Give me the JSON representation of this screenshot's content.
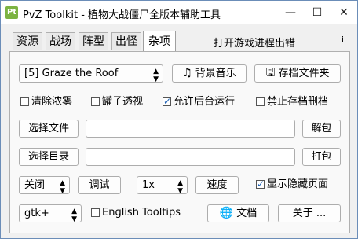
{
  "window": {
    "icon_text": "Pt",
    "title": "PvZ Toolkit - 植物大战僵尸全版本辅助工具",
    "minimize_glyph": "—",
    "maximize_glyph": "☐",
    "close_glyph": "✕"
  },
  "tabs": [
    "资源",
    "战场",
    "阵型",
    "出怪",
    "杂项"
  ],
  "active_tab": "杂项",
  "status_text": "打开游戏进程出错",
  "info_icon": "i",
  "misc": {
    "level_select": "[5] Graze the Roof",
    "bgm_button": "背景音乐",
    "bgm_icon": "music-note-icon",
    "save_folder_button": "存档文件夹",
    "save_folder_icon": "floppy-disk-icon",
    "checkboxes": [
      {
        "label": "清除浓雾",
        "checked": false
      },
      {
        "label": "罐子透视",
        "checked": false
      },
      {
        "label": "允许后台运行",
        "checked": true
      },
      {
        "label": "禁止存档删档",
        "checked": false
      }
    ],
    "select_file_button": "选择文件",
    "file_path": "",
    "unpack_button": "解包",
    "select_dir_button": "选择目录",
    "dir_path": "",
    "pack_button": "打包",
    "debug_mode_select": "关闭",
    "debug_button": "调试",
    "speed_select": "1x",
    "speed_button": "速度",
    "show_hidden_label": "显示隐藏页面",
    "show_hidden_checked": true,
    "theme_select": "gtk+",
    "english_tooltips_label": "English Tooltips",
    "english_tooltips_checked": false,
    "docs_button": "文档",
    "docs_icon": "globe-icon",
    "about_button": "关于 ..."
  }
}
